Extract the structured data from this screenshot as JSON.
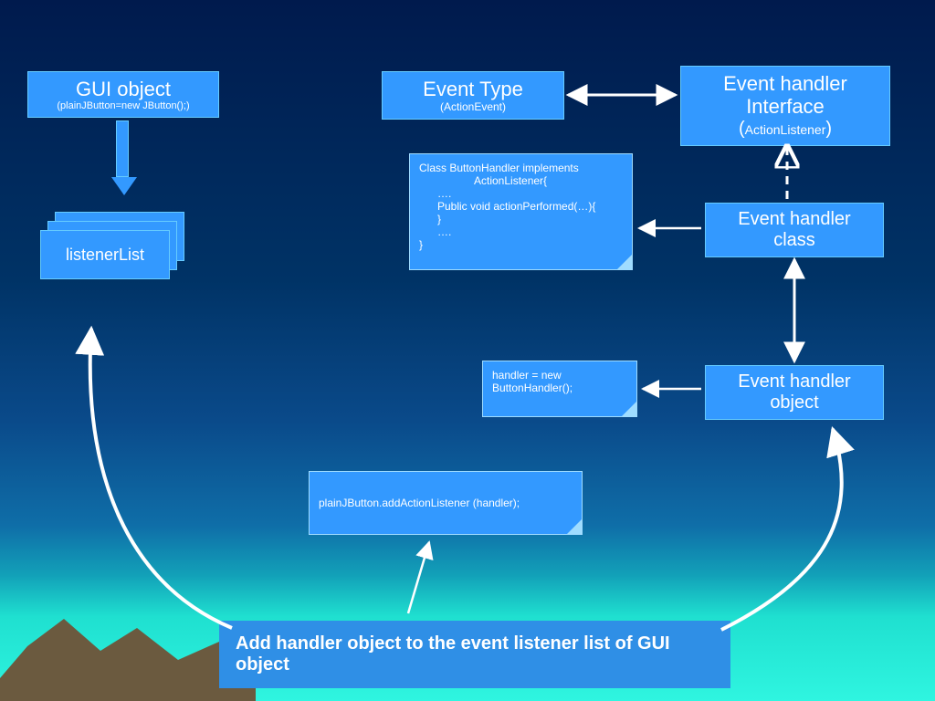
{
  "gui_object": {
    "title": "GUI  object",
    "subtitle": "(plainJButton=new JButton();)"
  },
  "event_type": {
    "title": "Event Type",
    "subtitle": "(ActionEvent)"
  },
  "event_handler_interface": {
    "line1": "Event handler",
    "line2": "Interface",
    "subtitle_open": "(",
    "subtitle_mid": "ActionListener",
    "subtitle_close": ")"
  },
  "listener_list": {
    "label": "listenerList"
  },
  "handler_class_note": {
    "l1": "Class ButtonHandler implements",
    "l2": "ActionListener{",
    "l3": "….",
    "l4": "Public void actionPerformed(…){",
    "l5": "}",
    "l6": "….",
    "l7": "}"
  },
  "event_handler_class": {
    "line1": "Event handler",
    "line2": "class"
  },
  "handler_object_note": {
    "l1": "handler = new",
    "l2": "ButtonHandler();"
  },
  "event_handler_object": {
    "line1": "Event handler",
    "line2": "object"
  },
  "add_listener_note": {
    "l1": "plainJButton.addActionListener (handler);"
  },
  "banner": {
    "text": "Add handler object to the event listener list of GUI object"
  },
  "colors": {
    "box": "#3399ff",
    "border": "#66ccff",
    "arrow": "#ffffff"
  }
}
